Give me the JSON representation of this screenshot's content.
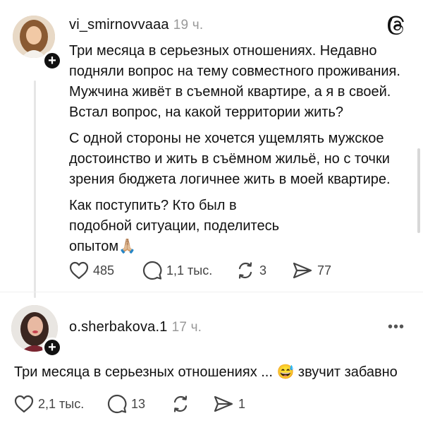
{
  "post": {
    "username": "vi_smirnovvaaa",
    "time": "19 ч.",
    "paragraph1": "Три месяца в серьезных отношениях. Недавно подняли вопрос на тему совместного проживания. Мужчина живёт в съемной квартире, а я в своей. Встал вопрос, на какой территории жить?",
    "paragraph2": "С одной стороны не хочется ущемлять мужское достоинство и жить в съёмном жильё, но с точки зрения бюджета логичнее жить в моей квартире.",
    "paragraph3": "Как поступить? Кто был в подобной ситуации, поделитесь опытом🙏🏼",
    "likes": "485",
    "comments": "1,1 тыс.",
    "reposts": "3",
    "shares": "77"
  },
  "comment": {
    "username": "o.sherbakova.1",
    "time": "17 ч.",
    "text": "Три месяца в серьезных отношениях ... 😅 звучит забавно",
    "likes": "2,1 тыс.",
    "comments": "13",
    "shares": "1"
  },
  "icons": {
    "logo": "threads-logo-icon",
    "like": "heart-icon",
    "comment": "comment-bubble-icon",
    "repost": "repost-icon",
    "share": "share-send-icon",
    "follow": "plus-icon",
    "more": "more-dots-icon"
  },
  "colors": {
    "text": "#111111",
    "muted": "#999999",
    "icon": "#444444"
  }
}
